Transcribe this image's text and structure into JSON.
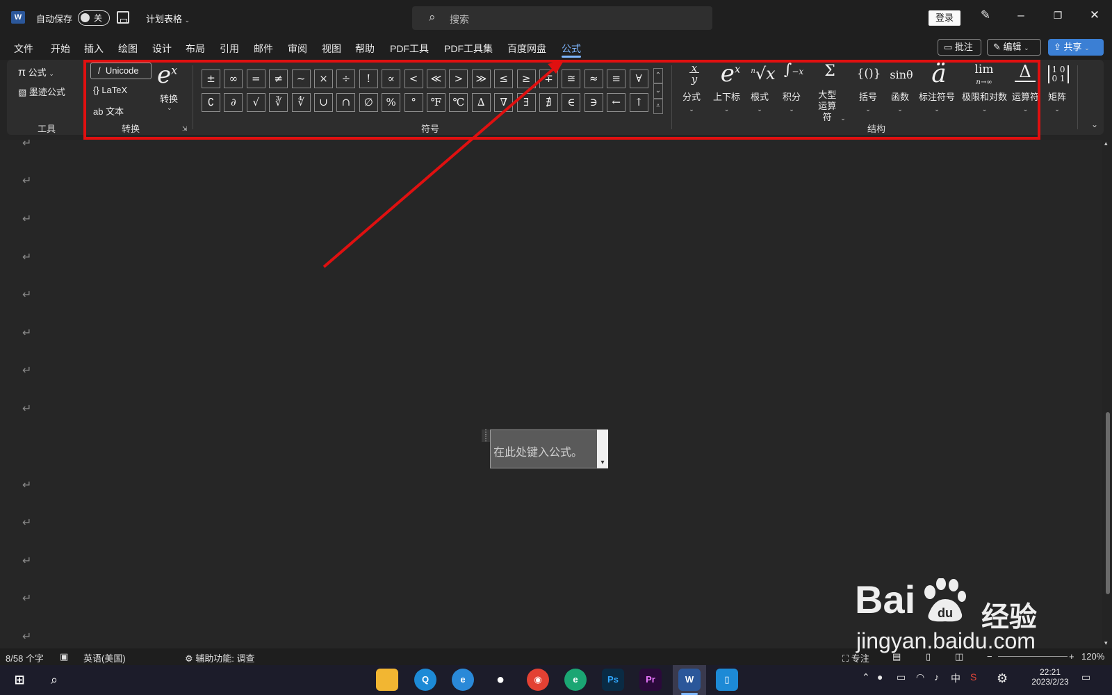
{
  "titlebar": {
    "autosave_label": "自动保存",
    "autosave_state": "关",
    "doc_title": "计划表格",
    "search_placeholder": "搜索",
    "login_label": "登录"
  },
  "menu": {
    "items": [
      "文件",
      "开始",
      "插入",
      "绘图",
      "设计",
      "布局",
      "引用",
      "邮件",
      "审阅",
      "视图",
      "帮助",
      "PDF工具",
      "PDF工具集",
      "百度网盘",
      "公式"
    ],
    "active": "公式",
    "comment_label": "批注",
    "edit_label": "编辑",
    "share_label": "共享"
  },
  "ribbon": {
    "tools": {
      "equation_label": "公式",
      "ink_label": "墨迹公式",
      "group_label": "工具"
    },
    "convert": {
      "unicode_label": "Unicode",
      "latex_label": "LaTeX",
      "text_label": "文本",
      "convert_label": "转换",
      "group_label": "转换"
    },
    "symbols": {
      "row1": [
        "±",
        "∞",
        "=",
        "≠",
        "~",
        "×",
        "÷",
        "!",
        "∝",
        "<",
        "≪",
        ">",
        "≫",
        "≤",
        "≥",
        "∓",
        "≅",
        "≈",
        "≡",
        "∀"
      ],
      "row2": [
        "∁",
        "∂",
        "√",
        "∛",
        "∜",
        "∪",
        "∩",
        "∅",
        "%",
        "°",
        "℉",
        "℃",
        "∆",
        "∇",
        "∃",
        "∄",
        "∈",
        "∋",
        "←",
        "↑"
      ],
      "group_label": "符号"
    },
    "structures": {
      "items": [
        {
          "label": "分式",
          "icon": "fraction-icon",
          "glyph": "x/y"
        },
        {
          "label": "上下标",
          "icon": "script-icon",
          "glyph": "eˣ"
        },
        {
          "label": "根式",
          "icon": "radical-icon",
          "glyph": "ⁿ√x"
        },
        {
          "label": "积分",
          "icon": "integral-icon",
          "glyph": "∫"
        },
        {
          "label": "大型运算符",
          "icon": "large-operator-icon",
          "glyph": "Σ"
        },
        {
          "label": "括号",
          "icon": "bracket-icon",
          "glyph": "{()}"
        },
        {
          "label": "函数",
          "icon": "function-icon",
          "glyph": "sinθ"
        },
        {
          "label": "标注符号",
          "icon": "accent-icon",
          "glyph": "ä"
        },
        {
          "label": "极限和对数",
          "icon": "limit-icon",
          "glyph": "lim"
        },
        {
          "label": "运算符",
          "icon": "operator-icon",
          "glyph": "Δ"
        },
        {
          "label": "矩阵",
          "icon": "matrix-icon",
          "glyph": "[10 01]"
        }
      ],
      "group_label": "结构"
    }
  },
  "document": {
    "equation_placeholder": "在此处键入公式。"
  },
  "statusbar": {
    "word_count": "8/58 个字",
    "language": "英语(美国)",
    "accessibility": "辅助功能: 调查",
    "focus_label": "专注",
    "zoom": "120%"
  },
  "taskbar": {
    "ime": "中",
    "time": "22:21",
    "date": "2023/2/23"
  },
  "watermark": {
    "brand": "Bai",
    "brand_suffix": "经验",
    "url": "jingyan.baidu.com"
  },
  "colors": {
    "accent": "#7eb6ff",
    "annotation_red": "#e01010",
    "share_blue": "#3b7fd4"
  }
}
